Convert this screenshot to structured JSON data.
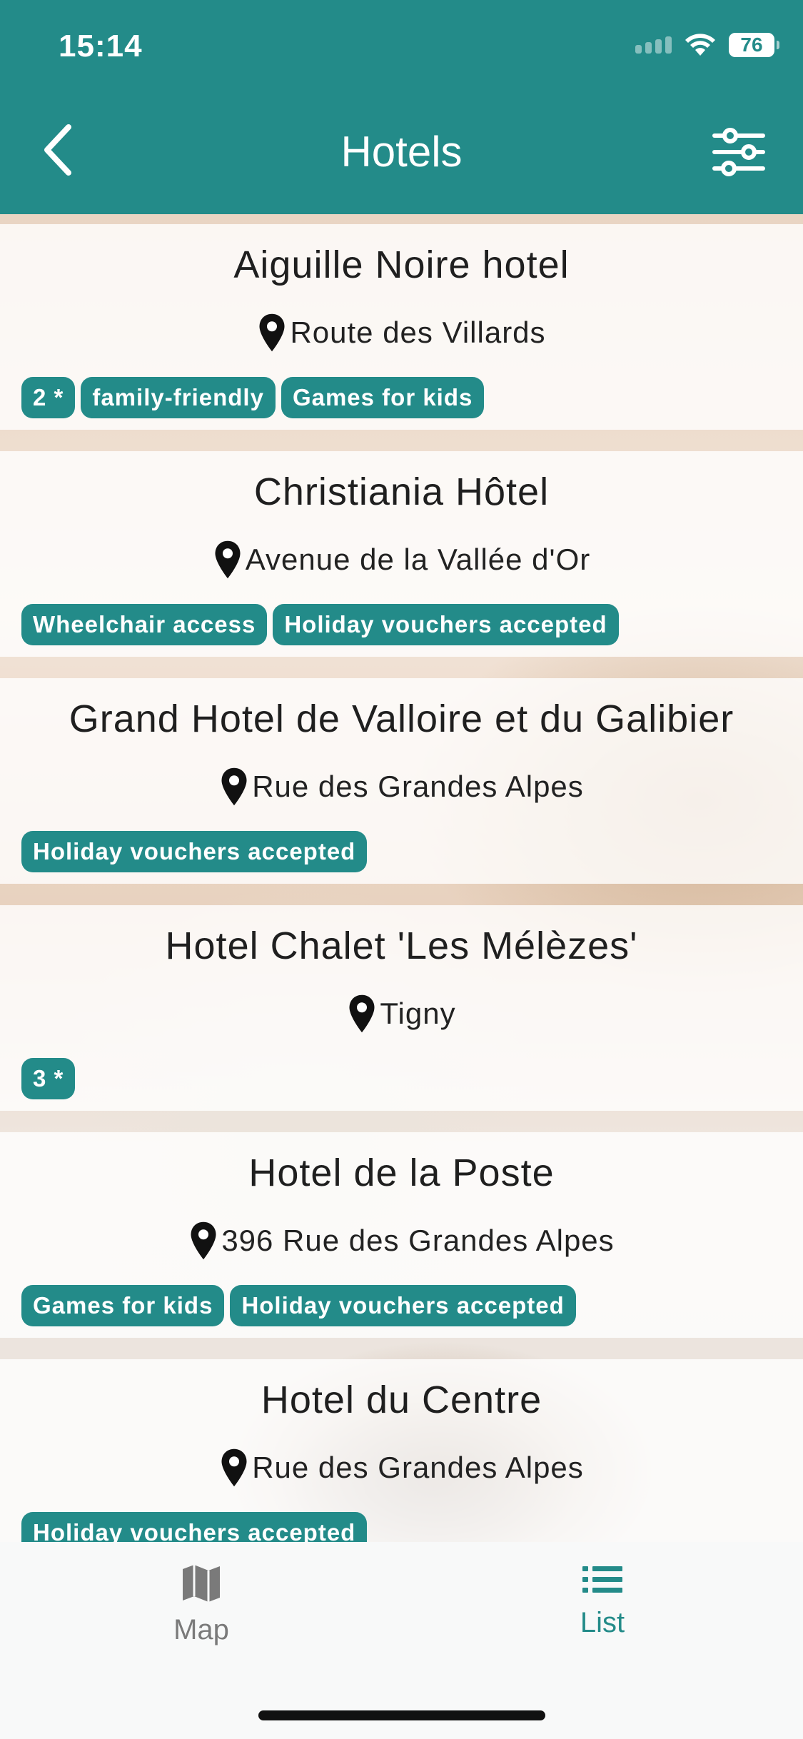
{
  "status_bar": {
    "time": "15:14",
    "battery": "76"
  },
  "header": {
    "title": "Hotels"
  },
  "hotels": [
    {
      "name": "Aiguille Noire hotel",
      "address": "Route des Villards",
      "tags": [
        "2 *",
        "family-friendly",
        "Games for kids"
      ]
    },
    {
      "name": "Christiania Hôtel",
      "address": "Avenue de la Vallée d'Or",
      "tags": [
        "Wheelchair access",
        "Holiday vouchers accepted"
      ]
    },
    {
      "name": "Grand Hotel de Valloire et du Galibier",
      "address": "Rue des Grandes Alpes",
      "tags": [
        "Holiday vouchers accepted"
      ]
    },
    {
      "name": "Hotel Chalet 'Les Mélèzes'",
      "address": "Tigny",
      "tags": [
        "3 *"
      ]
    },
    {
      "name": "Hotel de la Poste",
      "address": "396 Rue des Grandes Alpes",
      "tags": [
        "Games for kids",
        "Holiday vouchers accepted"
      ]
    },
    {
      "name": "Hotel du Centre",
      "address": "Rue des Grandes Alpes",
      "tags": [
        "Holiday vouchers accepted"
      ]
    }
  ],
  "tabbar": {
    "map_label": "Map",
    "list_label": "List",
    "active": "List"
  },
  "colors": {
    "accent": "#238b89"
  }
}
